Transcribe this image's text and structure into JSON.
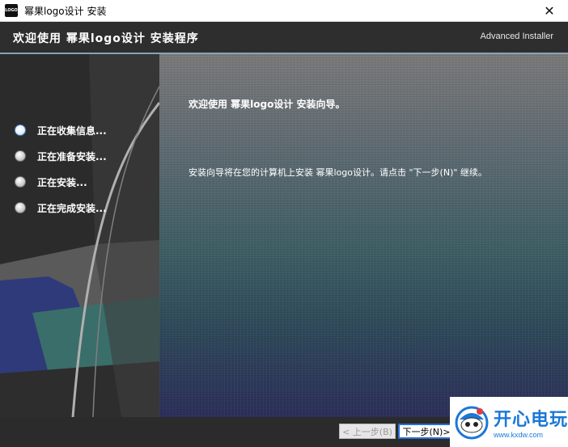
{
  "window": {
    "title": "幂果logo设计 安装",
    "logo_text": "LOGO",
    "close_glyph": "✕"
  },
  "header": {
    "title": "欢迎使用 幂果logo设计 安装程序",
    "brand": "Advanced Installer"
  },
  "steps": [
    {
      "label": "正在收集信息...",
      "active": true
    },
    {
      "label": "正在准备安装...",
      "active": false
    },
    {
      "label": "正在安装...",
      "active": false
    },
    {
      "label": "正在完成安装...",
      "active": false
    }
  ],
  "main": {
    "heading": "欢迎使用 幂果logo设计 安装向导。",
    "body": "安装向导将在您的计算机上安装 幂果logo设计。请点击 \"下一步(N)\" 继续。"
  },
  "buttons": {
    "back": "< 上一步(B)",
    "next": "下一步(N)>"
  },
  "watermark": {
    "main": "开心电玩",
    "sub": "www.kxdw.com"
  },
  "colors": {
    "header_bg": "#2e2e2e",
    "sidebar_bg": "#2b2b2b",
    "accent_blue": "#2a6fd6",
    "watermark_blue": "#1a78d8"
  }
}
